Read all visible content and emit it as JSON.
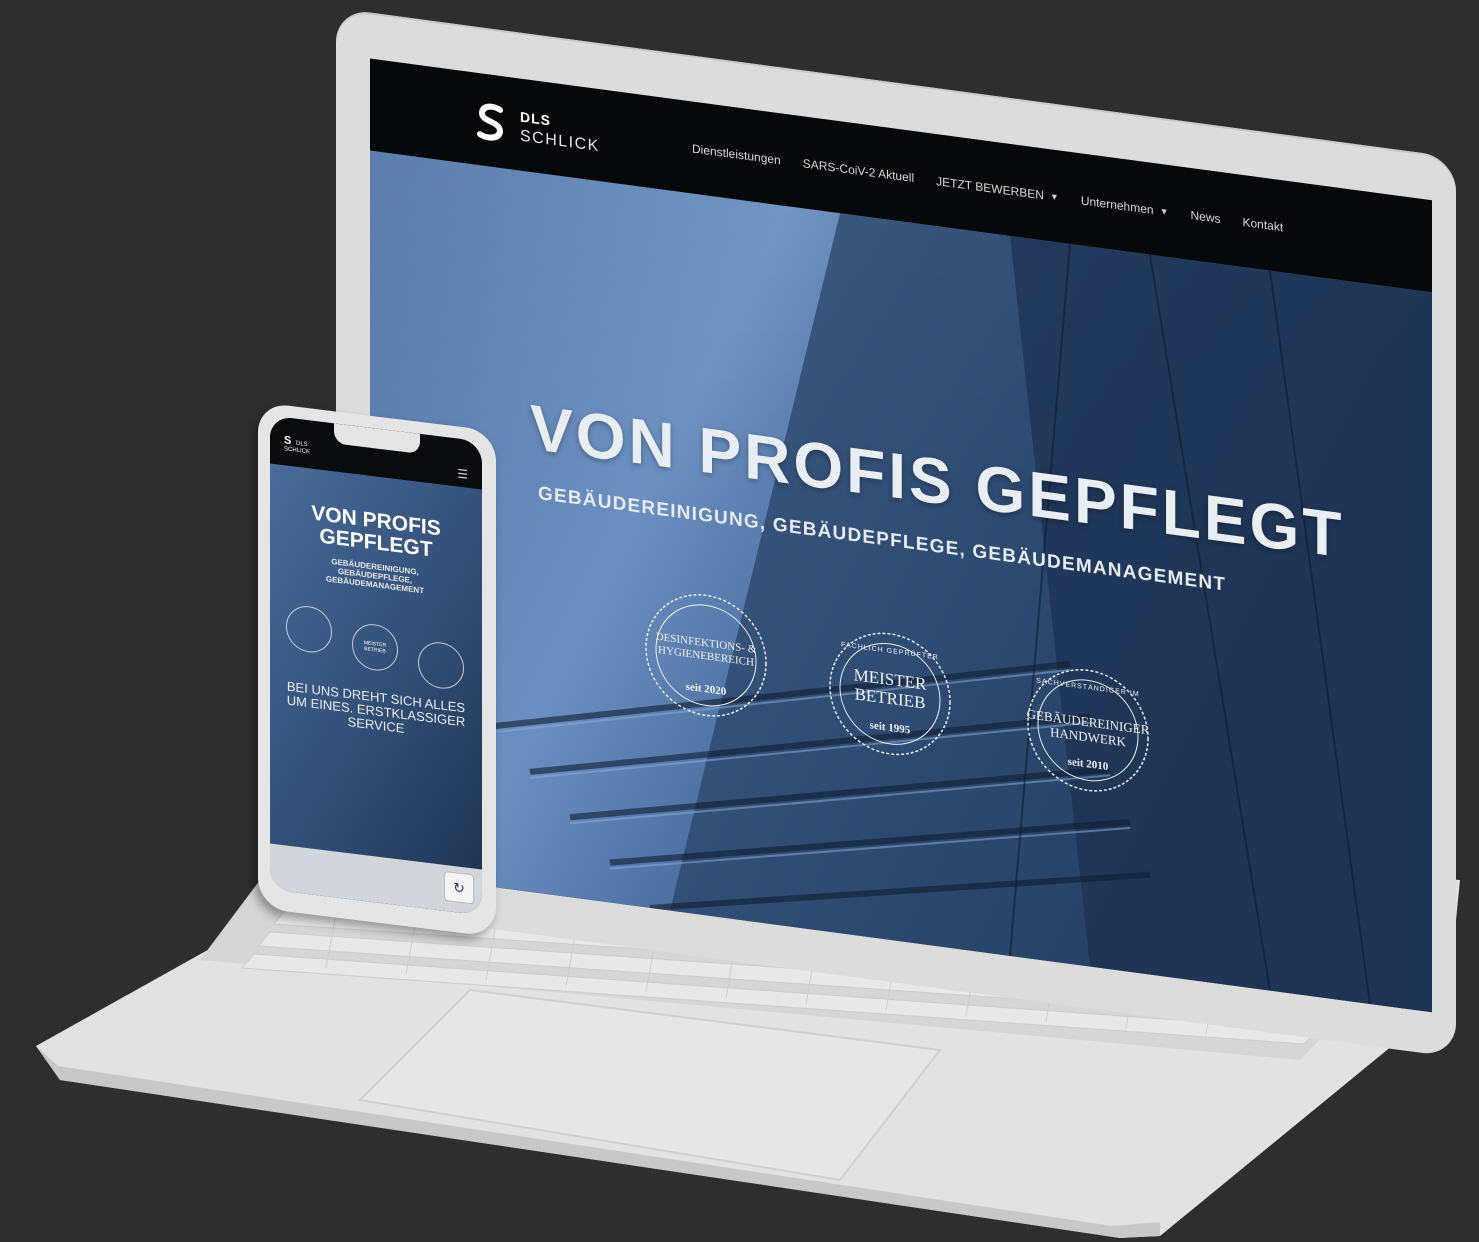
{
  "site": {
    "brand": {
      "line1": "DLS",
      "line2": "SCHLICK"
    },
    "nav": [
      {
        "label": "Dienstleistungen",
        "has_dropdown": false
      },
      {
        "label": "SARS-CoiV-2 Aktuell",
        "has_dropdown": false
      },
      {
        "label": "JETZT BEWERBEN",
        "has_dropdown": true
      },
      {
        "label": "Unternehmen",
        "has_dropdown": true
      },
      {
        "label": "News",
        "has_dropdown": false
      },
      {
        "label": "Kontakt",
        "has_dropdown": false
      }
    ],
    "hero": {
      "title": "VON PROFIS GEPFLEGT",
      "subtitle": "GEBÄUDEREINIGUNG, GEBÄUDEPFLEGE, GEBÄUDEMANAGEMENT"
    },
    "seals": [
      {
        "main": "DESINFEKTIONS- & HYGIENEBEREICH",
        "since": "seit 2020"
      },
      {
        "arc": "FACHLICH GEPRÜFTER",
        "main": "MEISTER BETRIEB",
        "since": "seit 1995"
      },
      {
        "arc": "SACHVERSTÄNDIGER IM",
        "main": "GEBÄUDEREINIGER HANDWERK",
        "since": "seit 2010"
      }
    ]
  },
  "phone": {
    "brand": {
      "line1": "DLS",
      "line2": "SCHLICK"
    },
    "title": "VON PROFIS GEPFLEGT",
    "subtitle": "GEBÄUDEREINIGUNG, GEBÄUDEPFLEGE, GEBÄUDEMANAGEMENT",
    "seals": [
      "",
      "MEISTER BETRIEB",
      ""
    ],
    "tagline": "BEI UNS DREHT SICH ALLES UM EINES. ERSTKLASSIGER SERVICE",
    "menu_icon": "hamburger-icon",
    "badge_icon": "recaptcha-icon"
  },
  "colors": {
    "background": "#2e2e2f",
    "device": "#dcdcdc",
    "header": "#070809",
    "hero_blue": "#4f73a6"
  }
}
